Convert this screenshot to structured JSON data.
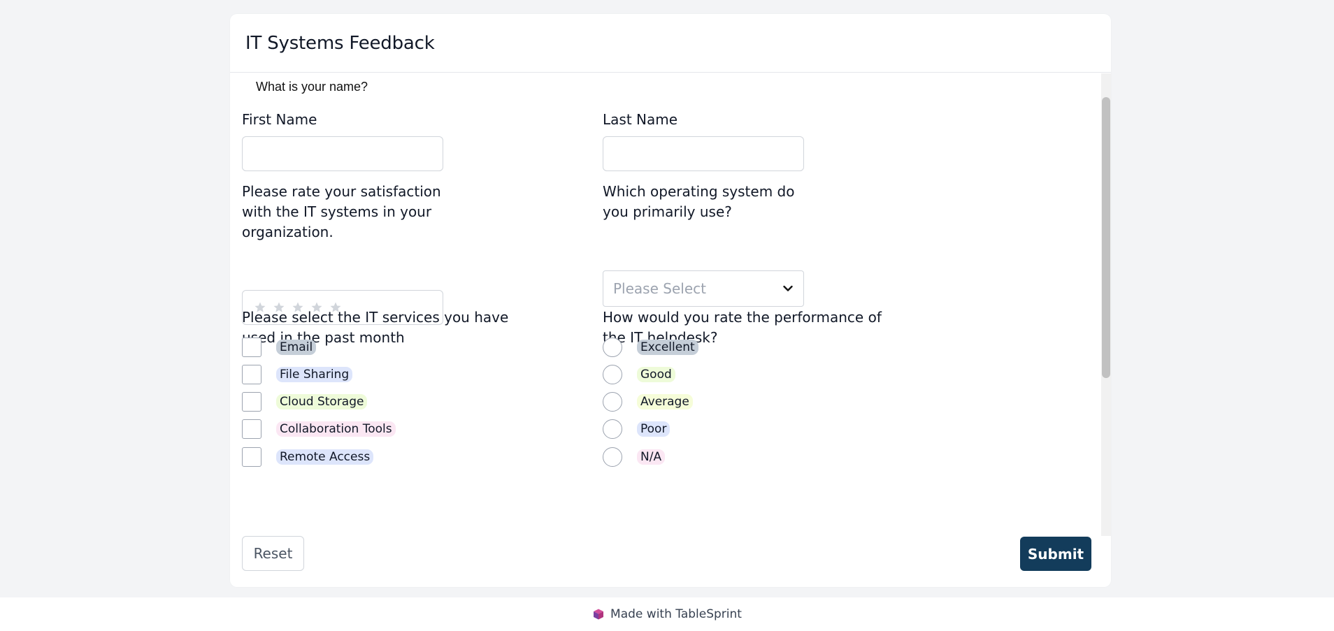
{
  "form": {
    "title": "IT Systems Feedback",
    "name_question": "What is your name?",
    "first_name": {
      "label": "First Name",
      "value": ""
    },
    "last_name": {
      "label": "Last Name",
      "value": ""
    },
    "satisfaction": {
      "label_lines": [
        "Please rate your satisfaction",
        "with the IT systems in your",
        "organization."
      ],
      "stars_max": 5,
      "stars_value": 0
    },
    "os": {
      "label_lines": [
        "Which operating system do",
        "you primarily use?"
      ],
      "placeholder": "Please Select",
      "icon": "chevron-down-icon"
    },
    "services": {
      "label_lines": [
        "Please select the IT services you have",
        "used in the past month"
      ],
      "options": [
        {
          "label": "Email",
          "color": "#c5ced8",
          "checked": false
        },
        {
          "label": "File Sharing",
          "color": "#dde5fb",
          "checked": false
        },
        {
          "label": "Cloud Storage",
          "color": "#eefbd9",
          "checked": false
        },
        {
          "label": "Collaboration Tools",
          "color": "#fbe7f3",
          "checked": false
        },
        {
          "label": "Remote Access",
          "color": "#dde5fb",
          "checked": false
        }
      ]
    },
    "helpdesk": {
      "label_lines": [
        "How would you rate the performance of",
        "the IT helpdesk?"
      ],
      "options": [
        {
          "label": "Excellent",
          "color": "#c5ced8",
          "selected": false
        },
        {
          "label": "Good",
          "color": "#eefbd9",
          "selected": false
        },
        {
          "label": "Average",
          "color": "#f6fdd9",
          "selected": false
        },
        {
          "label": "Poor",
          "color": "#dde5fb",
          "selected": false
        },
        {
          "label": "N/A",
          "color": "#fbe7f3",
          "selected": false
        }
      ]
    },
    "reset_label": "Reset",
    "submit_label": "Submit",
    "accent_color": "#133c5b"
  },
  "footer": {
    "text": "Made with TableSprint",
    "logo_icon": "tablesprint-cube-icon"
  }
}
